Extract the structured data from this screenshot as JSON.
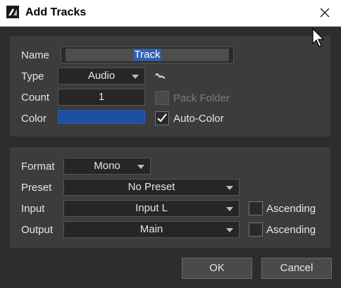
{
  "window": {
    "title": "Add Tracks"
  },
  "track": {
    "name_label": "Name",
    "name_value": "Track",
    "type_label": "Type",
    "type_value": "Audio",
    "count_label": "Count",
    "count_value": "1",
    "pack_folder_label": "Pack Folder",
    "color_label": "Color",
    "color_value": "#1f4fa0",
    "auto_color_label": "Auto-Color",
    "auto_color_checked": true
  },
  "io": {
    "format_label": "Format",
    "format_value": "Mono",
    "preset_label": "Preset",
    "preset_value": "No Preset",
    "input_label": "Input",
    "input_value": "Input L",
    "output_label": "Output",
    "output_value": "Main",
    "ascending_label": "Ascending"
  },
  "buttons": {
    "ok": "OK",
    "cancel": "Cancel"
  },
  "icons": {
    "app": "app-icon",
    "close": "close-icon",
    "type_menu": "waveform-icon",
    "check": "checkmark-icon",
    "cursor": "mouse-pointer-icon"
  }
}
